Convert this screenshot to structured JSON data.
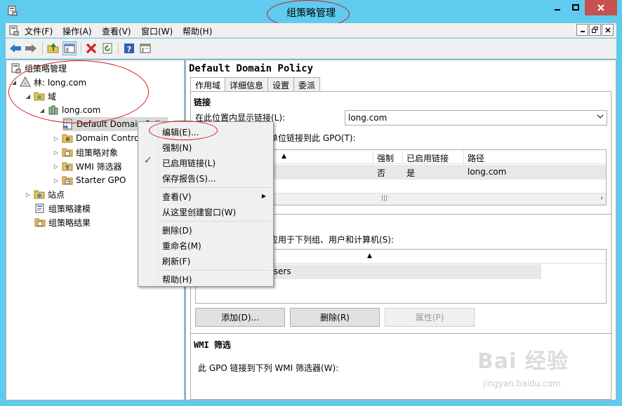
{
  "window": {
    "title": "组策略管理"
  },
  "menubar": {
    "items": [
      "文件(F)",
      "操作(A)",
      "查看(V)",
      "窗口(W)",
      "帮助(H)"
    ]
  },
  "toolbar": {
    "icons": [
      "back-arrow-icon",
      "forward-arrow-icon",
      "up-folder-icon",
      "show-hide-tree-icon",
      "delete-icon",
      "refresh-icon",
      "help-icon",
      "console-icon"
    ]
  },
  "tree": {
    "root": "组策略管理",
    "forest": "林: long.com",
    "domains": "域",
    "domain": "long.com",
    "items": [
      "Default Domain Poli",
      "Domain Contro",
      "组策略对象",
      "WMI 筛选器",
      "Starter GPO"
    ],
    "sites": "站点",
    "modeling": "组策略建模",
    "results": "组策略结果"
  },
  "right": {
    "gpo_title": "Default Domain Policy",
    "tabs": [
      "作用域",
      "详细信息",
      "设置",
      "委派"
    ],
    "links_header": "链接",
    "show_links_label": "在此位置内显示链接(L):",
    "show_links_value": "long.com",
    "linked_label": "单位链接到此 GPO(T):",
    "columns": [
      "强制",
      "已启用链接",
      "路径"
    ],
    "row": {
      "enforced": "否",
      "enabled": "是",
      "path": "long.com"
    },
    "filter_label": "应用于下列组、用户和计算机(S):",
    "filter_item": "Users",
    "buttons": {
      "add": "添加(D)...",
      "remove": "删除(R)",
      "properties": "属性(P)"
    },
    "wmi_header": "WMI 筛选",
    "wmi_label": "此 GPO 链接到下列 WMI 筛选器(W):"
  },
  "context_menu": {
    "items": [
      "编辑(E)...",
      "强制(N)",
      "已启用链接(L)",
      "保存报告(S)...",
      "查看(V)",
      "从这里创建窗口(W)",
      "删除(D)",
      "重命名(M)",
      "刷新(F)",
      "帮助(H)"
    ]
  },
  "watermark": {
    "brand": "Bai 经验",
    "url": "jingyan.baidu.com"
  }
}
